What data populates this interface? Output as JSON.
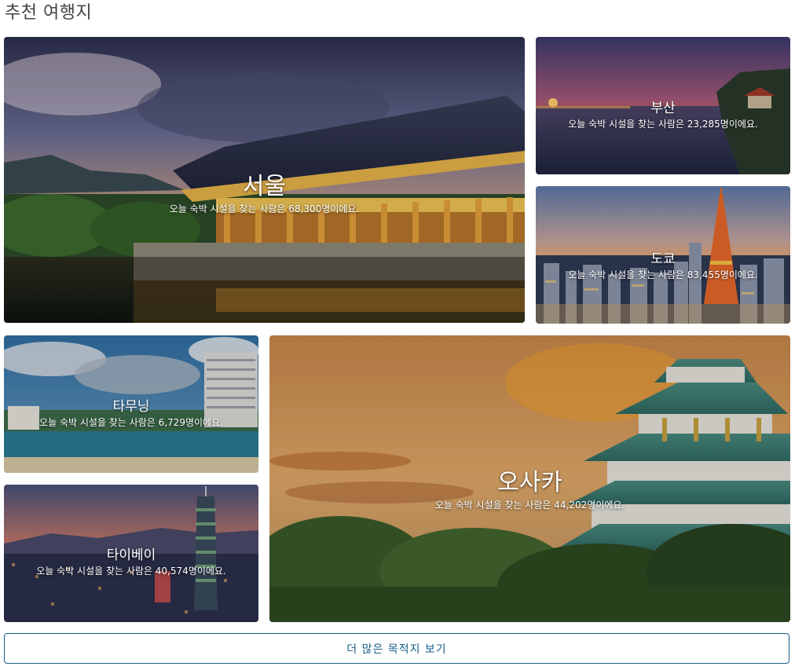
{
  "page": {
    "title": "추천 여행지"
  },
  "destinations": [
    {
      "name": "서울",
      "subtitle": "오늘 숙박 시설을 찾는 사람은 68,300명이에요."
    },
    {
      "name": "부산",
      "subtitle": "오늘 숙박 시설을 찾는 사람은 23,285명이에요."
    },
    {
      "name": "도쿄",
      "subtitle": "오늘 숙박 시설을 찾는 사람은 83,455명이에요."
    },
    {
      "name": "타무닝",
      "subtitle": "오늘 숙박 시설을 찾는 사람은 6,729명이에요."
    },
    {
      "name": "타이베이",
      "subtitle": "오늘 숙박 시설을 찾는 사람은 40,574명이에요."
    },
    {
      "name": "오사카",
      "subtitle": "오늘 숙박 시설을 찾는 사람은 44,202명이에요."
    }
  ],
  "more_button": {
    "label": "더 많은 목적지 보기"
  },
  "colors": {
    "accent": "#1a5f8a",
    "title_text": "#444444"
  }
}
